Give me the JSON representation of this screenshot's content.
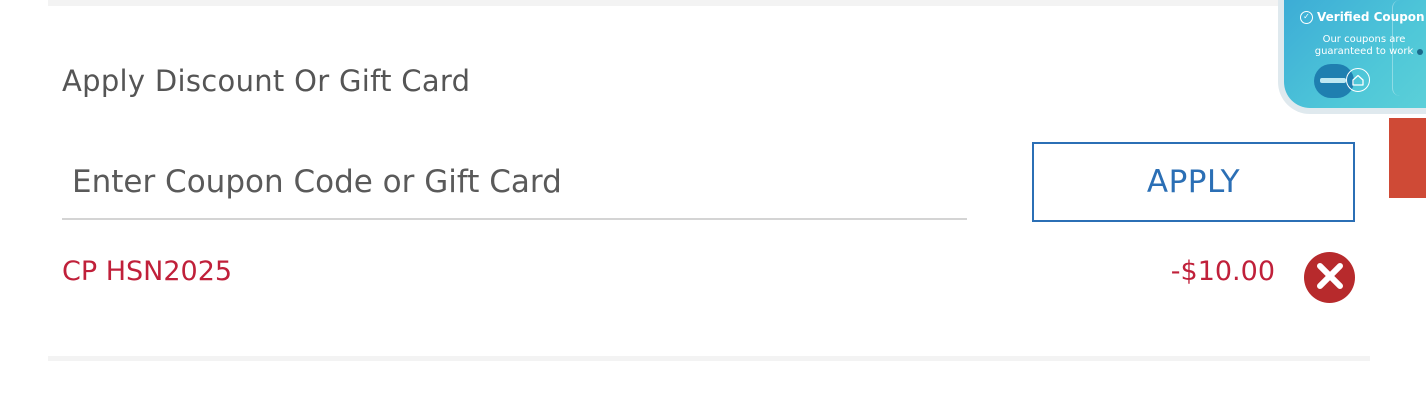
{
  "section": {
    "title": "Apply Discount Or Gift Card"
  },
  "coupon_input": {
    "placeholder": "Enter Coupon Code or Gift Card",
    "value": ""
  },
  "apply_button": {
    "label": "APPLY"
  },
  "applied_coupon": {
    "code_label": "CP HSN2025",
    "amount": "-$10.00"
  },
  "extension": {
    "title": "Verified Coupon",
    "subtitle": "Our coupons are guaranteed to work"
  },
  "colors": {
    "accent_blue": "#2b6fb5",
    "discount_red": "#c0203a",
    "remove_red": "#b72a2c",
    "side_tab": "#cf4a36"
  },
  "icons": {
    "remove": "close-circle-icon",
    "verified": "check-circle-icon",
    "home": "home-icon"
  }
}
